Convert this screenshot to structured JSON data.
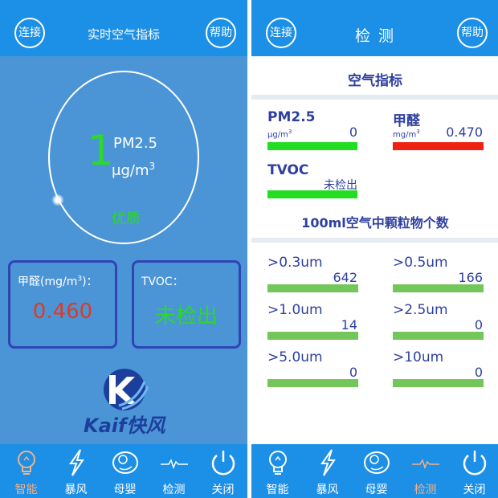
{
  "colors": {
    "bar_blue": "#1c8fe6",
    "panel_blue": "#4b95d6",
    "accent_green": "#2bd82b",
    "alert_red": "#e03a20",
    "text_navy": "#2e3fa0",
    "tab_active": "#f4b183"
  },
  "left_screen": {
    "connect_label": "连接",
    "help_label": "帮助",
    "title": "实时空气指标",
    "gauge": {
      "value": "1",
      "label": "PM2.5",
      "unit_base": "μg/m",
      "unit_exp": "3",
      "status": "优质"
    },
    "formaldehyde_card": {
      "label_base": "甲醛(mg/m",
      "label_exp": "3",
      "label_tail": ")：",
      "value": "0.460"
    },
    "tvoc_card": {
      "label": "TVOC：",
      "value": "未检出"
    },
    "logo": {
      "text": "Kaif快风",
      "icon": "kaif-logo-icon"
    }
  },
  "right_screen": {
    "connect_label": "连接",
    "help_label": "帮助",
    "title": "检 测",
    "air_section_title": "空气指标",
    "pm25": {
      "name": "PM2.5",
      "unit_base": "μg/m",
      "unit_exp": "3",
      "value": "0"
    },
    "formaldehyde": {
      "name": "甲醛",
      "unit_base": "mg/m",
      "unit_exp": "3",
      "value": "0.470"
    },
    "tvoc": {
      "name": "TVOC",
      "value": "未检出"
    },
    "particle_section_title": "100ml空气中颗粒物个数",
    "particles": [
      {
        "label": ">0.3um",
        "value": "642"
      },
      {
        "label": ">0.5um",
        "value": "166"
      },
      {
        "label": ">1.0um",
        "value": "14"
      },
      {
        "label": ">2.5um",
        "value": "0"
      },
      {
        "label": ">5.0um",
        "value": "0"
      },
      {
        "label": ">10um",
        "value": "0"
      }
    ]
  },
  "tabs": [
    {
      "label": "智能",
      "icon": "bulb-icon"
    },
    {
      "label": "暴风",
      "icon": "lightning-icon"
    },
    {
      "label": "母婴",
      "icon": "baby-icon"
    },
    {
      "label": "检测",
      "icon": "pulse-icon"
    },
    {
      "label": "关闭",
      "icon": "power-icon"
    }
  ],
  "active_tab": {
    "left_screen": "智能",
    "right_screen": "检测"
  }
}
